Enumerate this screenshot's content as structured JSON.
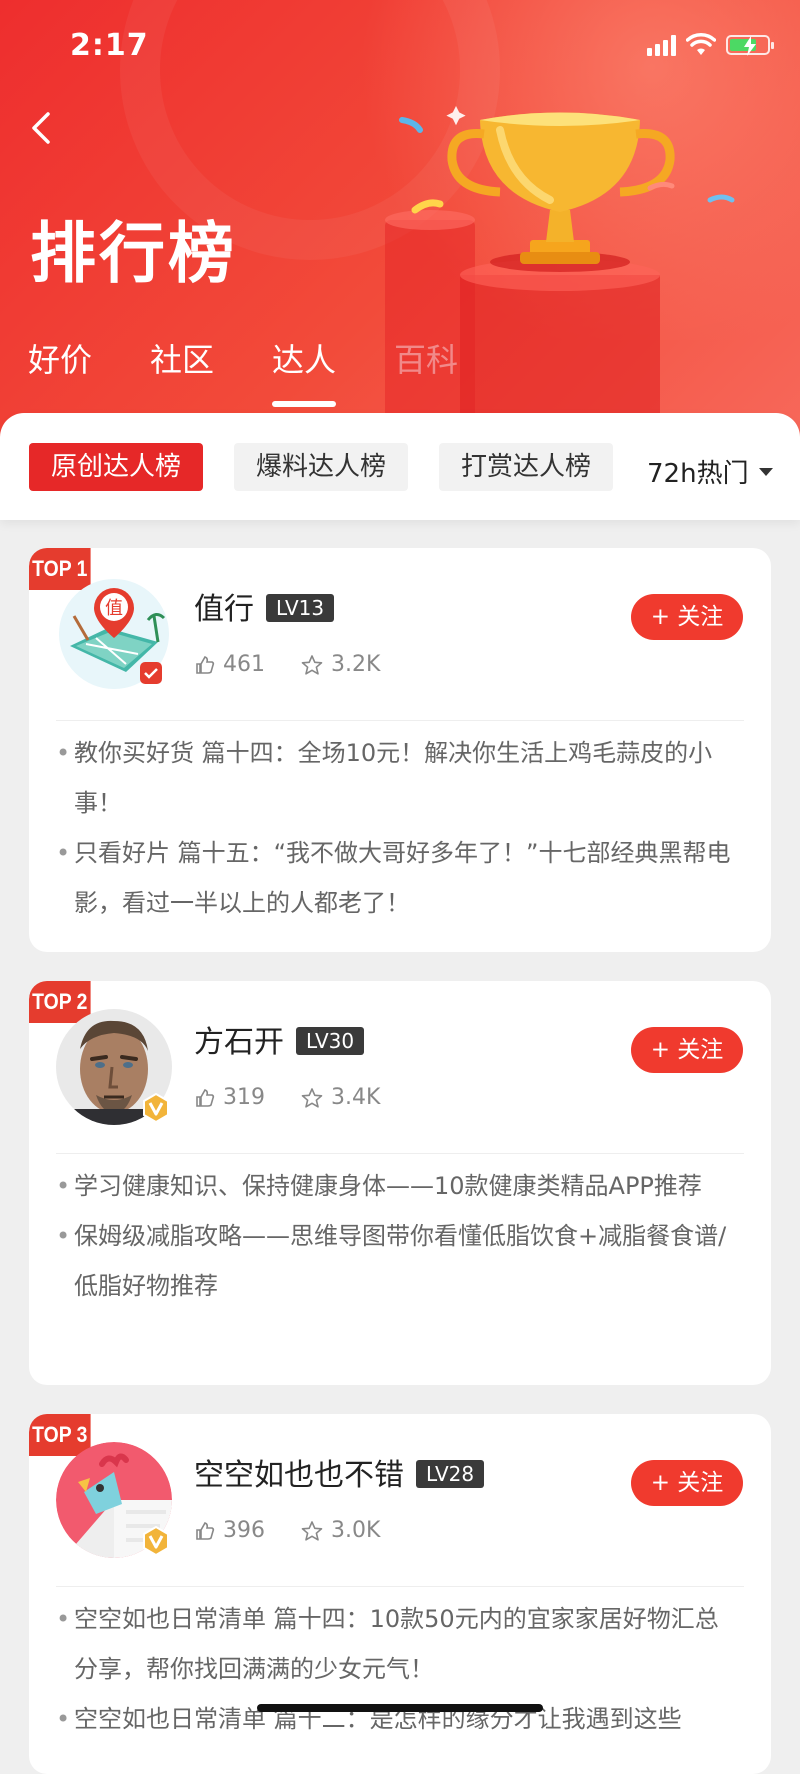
{
  "status": {
    "time": "2:17"
  },
  "header": {
    "title": "排行榜"
  },
  "tabs": [
    {
      "label": "好价"
    },
    {
      "label": "社区"
    },
    {
      "label": "达人",
      "active": true
    },
    {
      "label": "百科"
    }
  ],
  "filters": {
    "chips": [
      "原创达人榜",
      "爆料达人榜",
      "打赏达人榜"
    ],
    "active_index": 0,
    "sort": "72h热门"
  },
  "follow_label": "+ 关注",
  "users": [
    {
      "rank": "TOP 1",
      "name": "值行",
      "level": "LV13",
      "likes": "461",
      "favorites": "3.2K",
      "articles": [
        "教你买好货 篇十四：全场10元！解决你生活上鸡毛蒜皮的小事！",
        "只看好片 篇十五：“我不做大哥好多年了！”十七部经典黑帮电影，看过一半以上的人都老了！"
      ]
    },
    {
      "rank": "TOP 2",
      "name": "方石开",
      "level": "LV30",
      "likes": "319",
      "favorites": "3.4K",
      "articles": [
        "学习健康知识、保持健康身体——10款健康类精品APP推荐",
        "保姆级减脂攻略——思维导图带你看懂低脂饮食+减脂餐食谱/低脂好物推荐"
      ]
    },
    {
      "rank": "TOP 3",
      "name": "空空如也也不错",
      "level": "LV28",
      "likes": "396",
      "favorites": "3.0K",
      "articles": [
        "空空如也日常清单 篇十四：10款50元内的宜家家居好物汇总分享，帮你找回满满的少女元气！",
        "空空如也日常清单 篇十二：是怎样的缘分才让我遇到这些"
      ]
    }
  ],
  "colors": {
    "brand": "#e62828",
    "follow": "#f03a2e",
    "rank_badge": "#e53c2e"
  }
}
